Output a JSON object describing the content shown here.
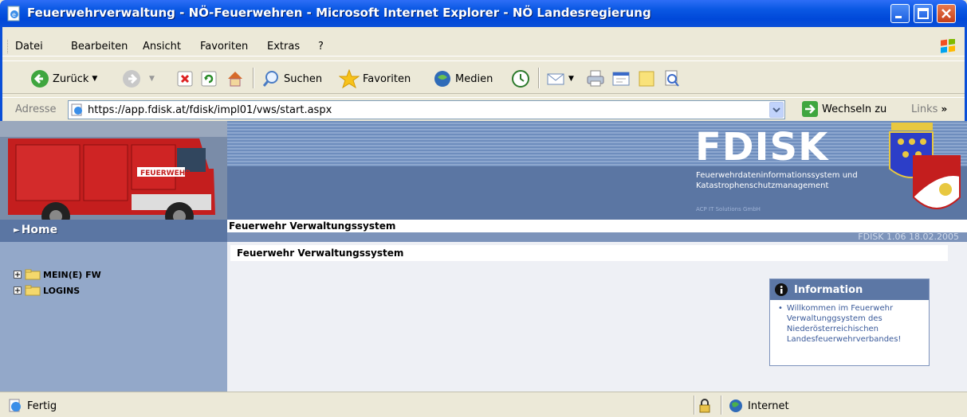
{
  "window": {
    "title": "Feuerwehrverwaltung - NÖ-Feuerwehren - Microsoft Internet Explorer - NÖ Landesregierung"
  },
  "menubar": {
    "items": [
      "Datei",
      "Bearbeiten",
      "Ansicht",
      "Favoriten",
      "Extras",
      "?"
    ]
  },
  "toolbar": {
    "back_label": "Zurück",
    "search_label": "Suchen",
    "favorites_label": "Favoriten",
    "media_label": "Medien"
  },
  "addressbar": {
    "label": "Adresse",
    "url": "https://app.fdisk.at/fdisk/impl01/vws/start.aspx",
    "go_label": "Wechseln zu",
    "links_label": "Links"
  },
  "banner": {
    "logo_text": "FDISK",
    "subtitle_line1": "Feuerwehrdateninformationssystem und",
    "subtitle_line2": "Katastrophenschutzmanagement",
    "company": "ACP IT Solutions GmbH",
    "app_title": "Feuerwehr Verwaltungssystem",
    "version": "FDISK 1.06 18.02.2005",
    "home_label": "Home",
    "truck_label": "FEUERWEHR"
  },
  "sidebar": {
    "items": [
      {
        "label": "MEIN(E) FW"
      },
      {
        "label": "LOGINS"
      }
    ]
  },
  "content": {
    "title": "Feuerwehr Verwaltungssystem",
    "info": {
      "heading": "Information",
      "text": "Willkommen im Feuerwehr Verwaltunggsystem des Niederösterreichischen Landesfeuerwehrverbandes!"
    }
  },
  "statusbar": {
    "status": "Fertig",
    "zone": "Internet"
  }
}
